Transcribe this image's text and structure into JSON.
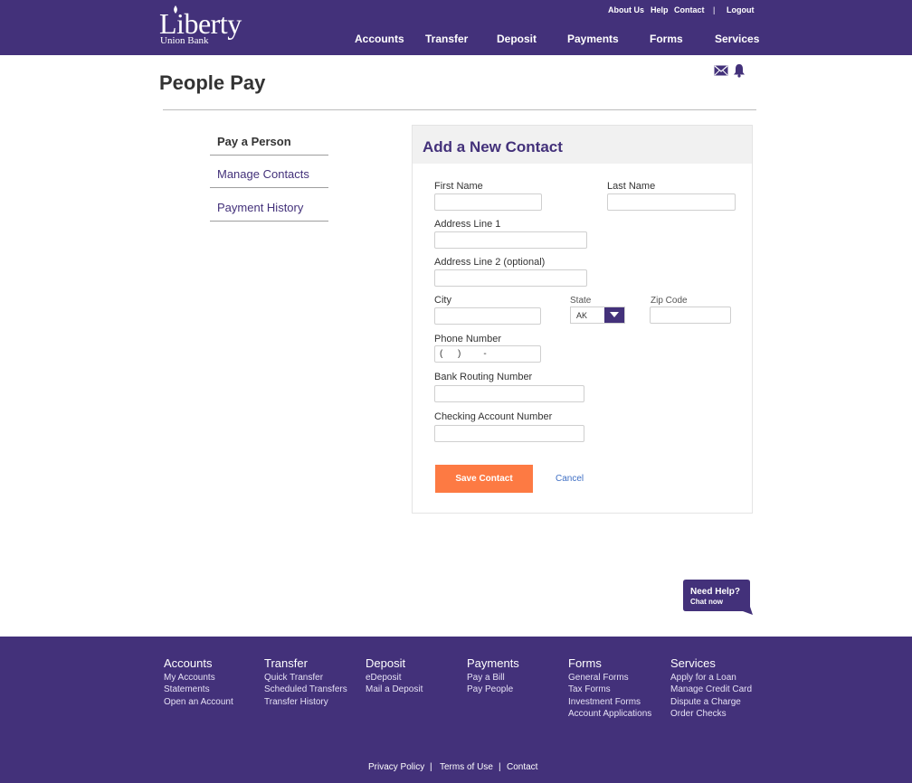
{
  "brand": {
    "name": "Liberty",
    "sub": "Union Bank",
    "primary_color": "#43317a",
    "accent_color": "#fd7a43",
    "link_color": "#3f6fc4"
  },
  "header": {
    "utility_links": [
      "About Us",
      "Help",
      "Contact",
      "Logout"
    ],
    "utility_separator": "|",
    "nav": [
      "Accounts",
      "Transfer",
      "Deposit",
      "Payments",
      "Forms",
      "Services"
    ],
    "icons": [
      "mail-icon",
      "bell-icon"
    ]
  },
  "page": {
    "title": "People Pay"
  },
  "sidebar": {
    "items": [
      {
        "label": "Pay a Person",
        "active": true
      },
      {
        "label": "Manage Contacts",
        "active": false
      },
      {
        "label": "Payment History",
        "active": false
      }
    ]
  },
  "form": {
    "title": "Add a New Contact",
    "first_name": {
      "label": "First Name",
      "value": ""
    },
    "last_name": {
      "label": "Last Name",
      "value": ""
    },
    "address1": {
      "label": "Address Line 1",
      "value": ""
    },
    "address2": {
      "label": "Address Line 2 (optional)",
      "value": ""
    },
    "city": {
      "label": "City",
      "value": ""
    },
    "state": {
      "label": "State",
      "value": "AK"
    },
    "zip": {
      "label": "Zip Code",
      "value": ""
    },
    "phone": {
      "label": "Phone Number",
      "mask": "(      )         -"
    },
    "routing": {
      "label": "Bank Routing Number",
      "value": ""
    },
    "checking": {
      "label": "Checking Account Number",
      "value": ""
    },
    "save_label": "Save Contact",
    "cancel_label": "Cancel"
  },
  "chat": {
    "title": "Need Help?",
    "subtitle": "Chat now"
  },
  "footer": {
    "columns": [
      {
        "heading": "Accounts",
        "links": [
          "My Accounts",
          "Statements",
          "Open an Account"
        ]
      },
      {
        "heading": "Transfer",
        "links": [
          "Quick Transfer",
          "Scheduled Transfers",
          "Transfer History"
        ]
      },
      {
        "heading": "Deposit",
        "links": [
          "eDeposit",
          "Mail a Deposit"
        ]
      },
      {
        "heading": "Payments",
        "links": [
          "Pay a Bill",
          "Pay People"
        ]
      },
      {
        "heading": "Forms",
        "links": [
          "General Forms",
          "Tax Forms",
          "Investment Forms",
          "Account Applications"
        ]
      },
      {
        "heading": "Services",
        "links": [
          "Apply for a Loan",
          "Manage Credit Card",
          "Dispute a Charge",
          "Order Checks"
        ]
      }
    ],
    "legal": [
      "Privacy Policy",
      "Terms of Use",
      "Contact"
    ],
    "legal_separator": "|"
  }
}
